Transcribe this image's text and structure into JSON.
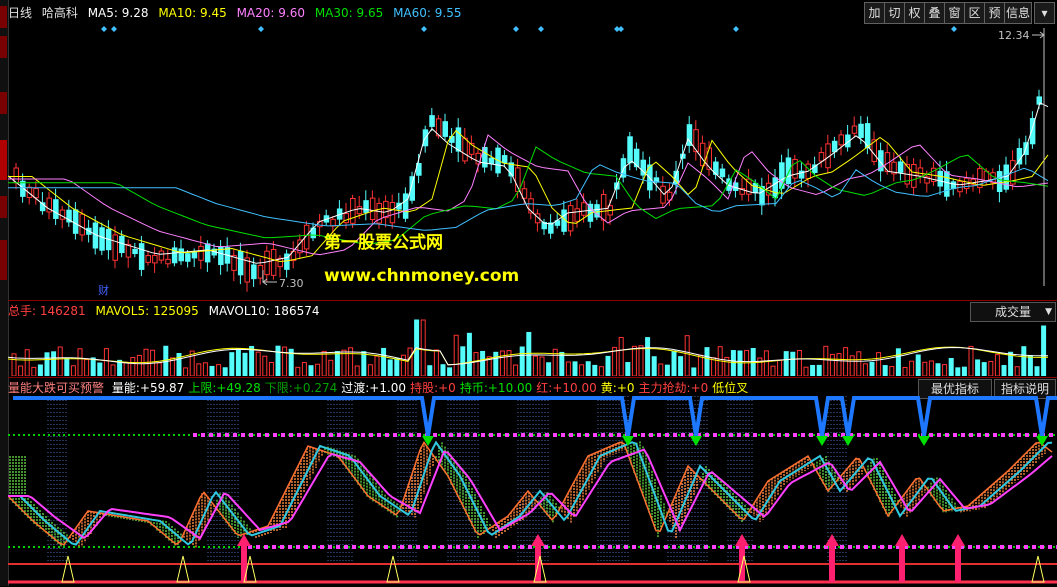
{
  "left_tabs": [
    "",
    "",
    "",
    "",
    "",
    ""
  ],
  "price_header": {
    "period": "日线",
    "stock": "哈高科",
    "ma5": {
      "label": "MA5:",
      "value": "9.28",
      "color": "#ffffff"
    },
    "ma10": {
      "label": "MA10:",
      "value": "9.45",
      "color": "#ffff00"
    },
    "ma20": {
      "label": "MA20:",
      "value": "9.60",
      "color": "#ff80ff"
    },
    "ma30": {
      "label": "MA30:",
      "value": "9.65",
      "color": "#00e000"
    },
    "ma60": {
      "label": "MA60:",
      "value": "9.55",
      "color": "#40c0ff"
    }
  },
  "toolbar": [
    "加",
    "切",
    "权",
    "叠",
    "窗",
    "区",
    "预",
    "信息"
  ],
  "price_annotations": {
    "high": "12.34",
    "low": "7.30",
    "finance": "财"
  },
  "watermark": {
    "line1": "第一股票公式网",
    "line2": "www.chnmoney.com"
  },
  "volume_header": {
    "total": {
      "label": "总手:",
      "value": "146281",
      "color": "#ff4040"
    },
    "mavol5": {
      "label": "MAVOL5:",
      "value": "125095",
      "color": "#ffff00"
    },
    "mavol10": {
      "label": "MAVOL10:",
      "value": "186574",
      "color": "#ffffff"
    }
  },
  "volume_dropdown": "成交量",
  "indicator_header": {
    "name": "量能大跌可买预警",
    "items": [
      {
        "label": "量能:",
        "value": "+59.87",
        "color": "#ffffff"
      },
      {
        "label": "上限:",
        "value": "+49.28",
        "color": "#00e000"
      },
      {
        "label": "下限:",
        "value": "+0.274",
        "color": "#00a000"
      },
      {
        "label": "过渡:",
        "value": "+1.00",
        "color": "#ffffff"
      },
      {
        "label": "持股:",
        "value": "+0",
        "color": "#ff4040"
      },
      {
        "label": "持币:",
        "value": "+10.00",
        "color": "#00e000"
      },
      {
        "label": "红:",
        "value": "+10.00",
        "color": "#ff4040"
      },
      {
        "label": "黄:",
        "value": "+0",
        "color": "#ffff00"
      },
      {
        "label": "主力抢劫:",
        "value": "+0",
        "color": "#ff4040"
      },
      {
        "label": "低位叉",
        "value": "",
        "color": "#ffff00"
      }
    ]
  },
  "indicator_buttons": {
    "best": "最优指标",
    "help": "指标说明"
  },
  "colors": {
    "up": "#ff3232",
    "down": "#54fcfc",
    "border": "#8a0000"
  }
}
